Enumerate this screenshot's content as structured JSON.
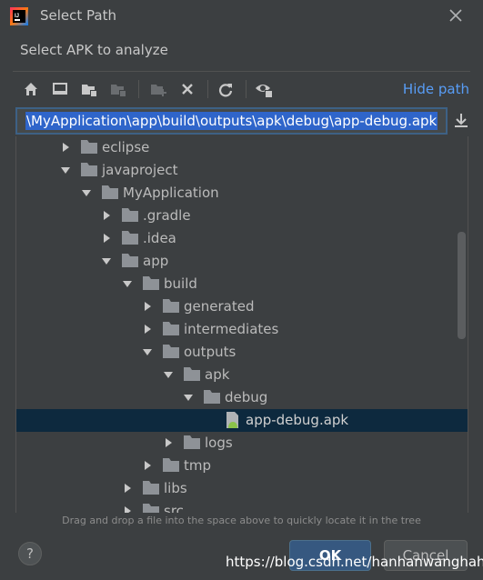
{
  "window": {
    "title": "Select Path",
    "subtitle": "Select APK to analyze"
  },
  "toolbar": {
    "buttons": [
      "home-icon",
      "desktop-icon",
      "project-folder-icon",
      "module-folder-icon",
      "new-folder-icon",
      "delete-icon",
      "refresh-icon",
      "show-hidden-icon"
    ],
    "hide_path_label": "Hide path"
  },
  "path_field": {
    "value": "\\MyApplication\\app\\build\\outputs\\apk\\debug\\app-debug.apk"
  },
  "tree": {
    "items": [
      {
        "label": "eclipse",
        "type": "folder",
        "expanded": false
      },
      {
        "label": "javaproject",
        "type": "folder",
        "expanded": true
      },
      {
        "label": "MyApplication",
        "type": "folder",
        "expanded": true
      },
      {
        "label": ".gradle",
        "type": "folder",
        "expanded": false
      },
      {
        "label": ".idea",
        "type": "folder",
        "expanded": false
      },
      {
        "label": "app",
        "type": "folder",
        "expanded": true
      },
      {
        "label": "build",
        "type": "folder",
        "expanded": true
      },
      {
        "label": "generated",
        "type": "folder",
        "expanded": false
      },
      {
        "label": "intermediates",
        "type": "folder",
        "expanded": false
      },
      {
        "label": "outputs",
        "type": "folder",
        "expanded": true
      },
      {
        "label": "apk",
        "type": "folder",
        "expanded": true
      },
      {
        "label": "debug",
        "type": "folder",
        "expanded": true
      },
      {
        "label": "app-debug.apk",
        "type": "file",
        "selected": true
      },
      {
        "label": "logs",
        "type": "folder",
        "expanded": false
      },
      {
        "label": "tmp",
        "type": "folder",
        "expanded": false
      },
      {
        "label": "libs",
        "type": "folder",
        "expanded": false
      },
      {
        "label": "src",
        "type": "folder",
        "expanded": false
      }
    ]
  },
  "hint": "Drag and drop a file into the space above to quickly locate it in the tree",
  "buttons": {
    "help": "?",
    "ok": "OK",
    "cancel": "Cancel"
  },
  "watermark": "https://blog.csdn.net/hanhanwanghaha",
  "colors": {
    "background": "#3c3f41",
    "accent": "#589df6",
    "selection": "#0d293e",
    "path_selection": "#2f65ca",
    "ok_button": "#365880"
  }
}
